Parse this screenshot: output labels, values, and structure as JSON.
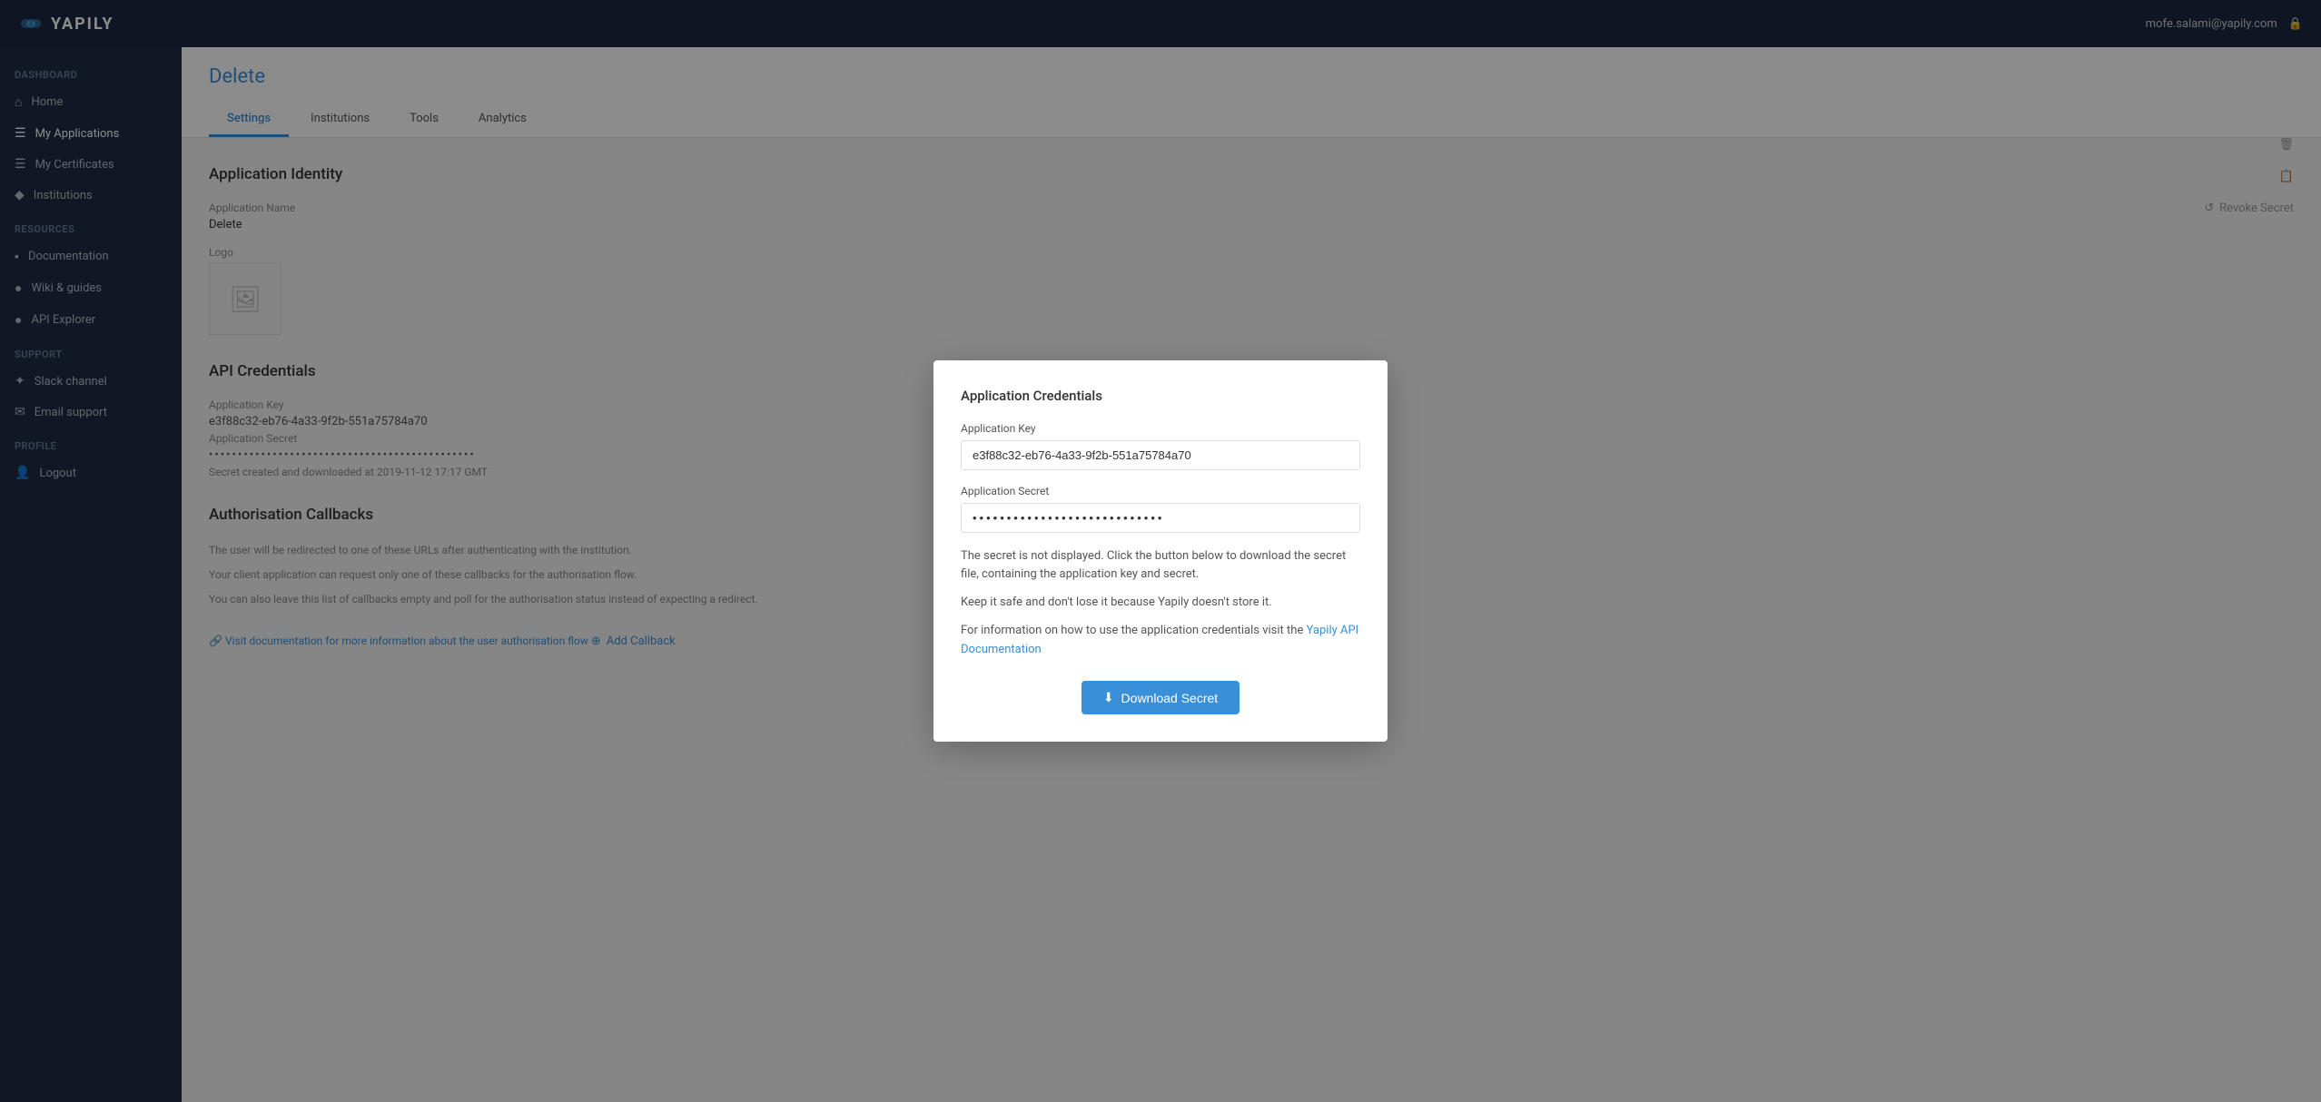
{
  "navbar": {
    "brand": "YAPILY",
    "user_email": "mofe.salami@yapily.com",
    "user_icon": "👤"
  },
  "sidebar": {
    "dashboard_label": "Dashboard",
    "items": [
      {
        "id": "home",
        "label": "Home",
        "icon": "⌂"
      },
      {
        "id": "my-applications",
        "label": "My Applications",
        "icon": "☰"
      },
      {
        "id": "my-certificates",
        "label": "My Certificates",
        "icon": "☰"
      },
      {
        "id": "institutions",
        "label": "Institutions",
        "icon": "◆"
      }
    ],
    "resources_label": "Resources",
    "resource_items": [
      {
        "id": "documentation",
        "label": "Documentation",
        "icon": "▪"
      },
      {
        "id": "wiki-guides",
        "label": "Wiki & guides",
        "icon": "●"
      },
      {
        "id": "api-explorer",
        "label": "API Explorer",
        "icon": "●"
      }
    ],
    "support_label": "Support",
    "support_items": [
      {
        "id": "slack-channel",
        "label": "Slack channel",
        "icon": "✦"
      },
      {
        "id": "email-support",
        "label": "Email support",
        "icon": "✉"
      }
    ],
    "profile_label": "Profile",
    "profile_items": [
      {
        "id": "logout",
        "label": "Logout",
        "icon": "👤"
      }
    ]
  },
  "page": {
    "title": "Delete",
    "tabs": [
      {
        "id": "settings",
        "label": "Settings",
        "active": true
      },
      {
        "id": "institutions",
        "label": "Institutions",
        "active": false
      },
      {
        "id": "tools",
        "label": "Tools",
        "active": false
      },
      {
        "id": "analytics",
        "label": "Analytics",
        "active": false
      }
    ]
  },
  "application_identity": {
    "section_title": "Application Identity",
    "name_label": "Application Name",
    "name_value": "Delete",
    "logo_label": "Logo",
    "logo_icon": "🖼"
  },
  "api_credentials": {
    "section_title": "API Credentials",
    "key_label": "Application Key",
    "key_value": "e3f88c32-eb76-4a33-9f2b-551a75784a70",
    "secret_label": "Application Secret",
    "secret_value": "••••••••••••••••••••••••••••••••••••••••••••••",
    "secret_created": "Secret created and downloaded at 2019-11-12 17:17 GMT"
  },
  "auth_callbacks": {
    "section_title": "Authorisation Callbacks",
    "description_line1": "The user will be redirected to one of these URLs after authenticating with the institution.",
    "description_line2": "Your client application can request only one of these callbacks for the authorisation flow.",
    "description_line3": "You can also leave this list of callbacks empty and poll for the authorisation status instead of expecting a redirect.",
    "doc_link": "Visit documentation for more information about the user authorisation flow",
    "add_callback": "Add Callback"
  },
  "right_actions": {
    "copy_icon": "📋",
    "revoke_label": "Revoke Secret",
    "revoke_icon": "↺",
    "delete_icon": "🗑"
  },
  "modal": {
    "title": "Application Credentials",
    "key_label": "Application Key",
    "key_value": "e3f88c32-eb76-4a33-9f2b-551a75784a70",
    "secret_label": "Application Secret",
    "secret_placeholder": "••••••••••••••••••••••••••••",
    "info_line1": "The secret is not displayed. Click the button below to download the secret file, containing the application key and secret.",
    "info_line2": "Keep it safe and don't lose it because Yapily doesn't store it.",
    "info_line3": "For information on how to use the application credentials visit the ",
    "info_link": "Yapily API Documentation",
    "download_btn": "Download Secret"
  }
}
